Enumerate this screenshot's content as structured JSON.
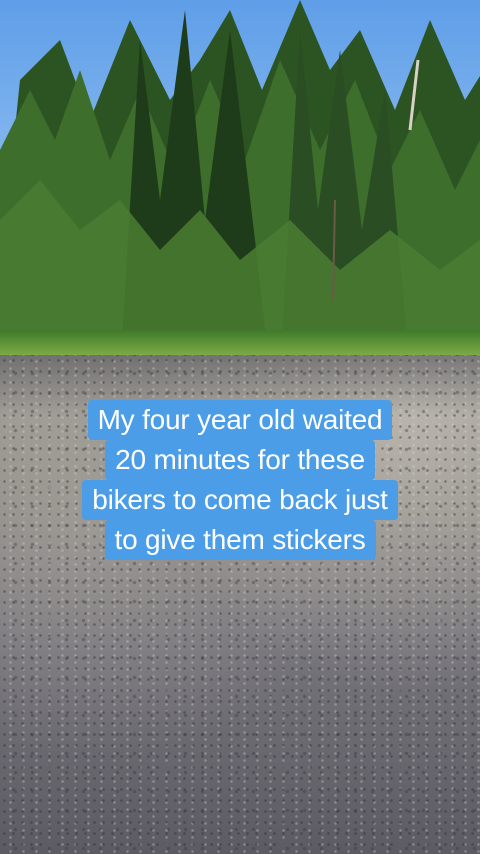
{
  "caption": {
    "lines": [
      "My four year old waited",
      "20 minutes for these",
      "bikers to come back just",
      "to give them stickers"
    ],
    "background_color": "#4a9de6",
    "text_color": "#ffffff"
  },
  "scene": {
    "sky_color": "#6aa6ea",
    "tree_color": "#2f5a26",
    "road_color": "#8e8b86"
  }
}
